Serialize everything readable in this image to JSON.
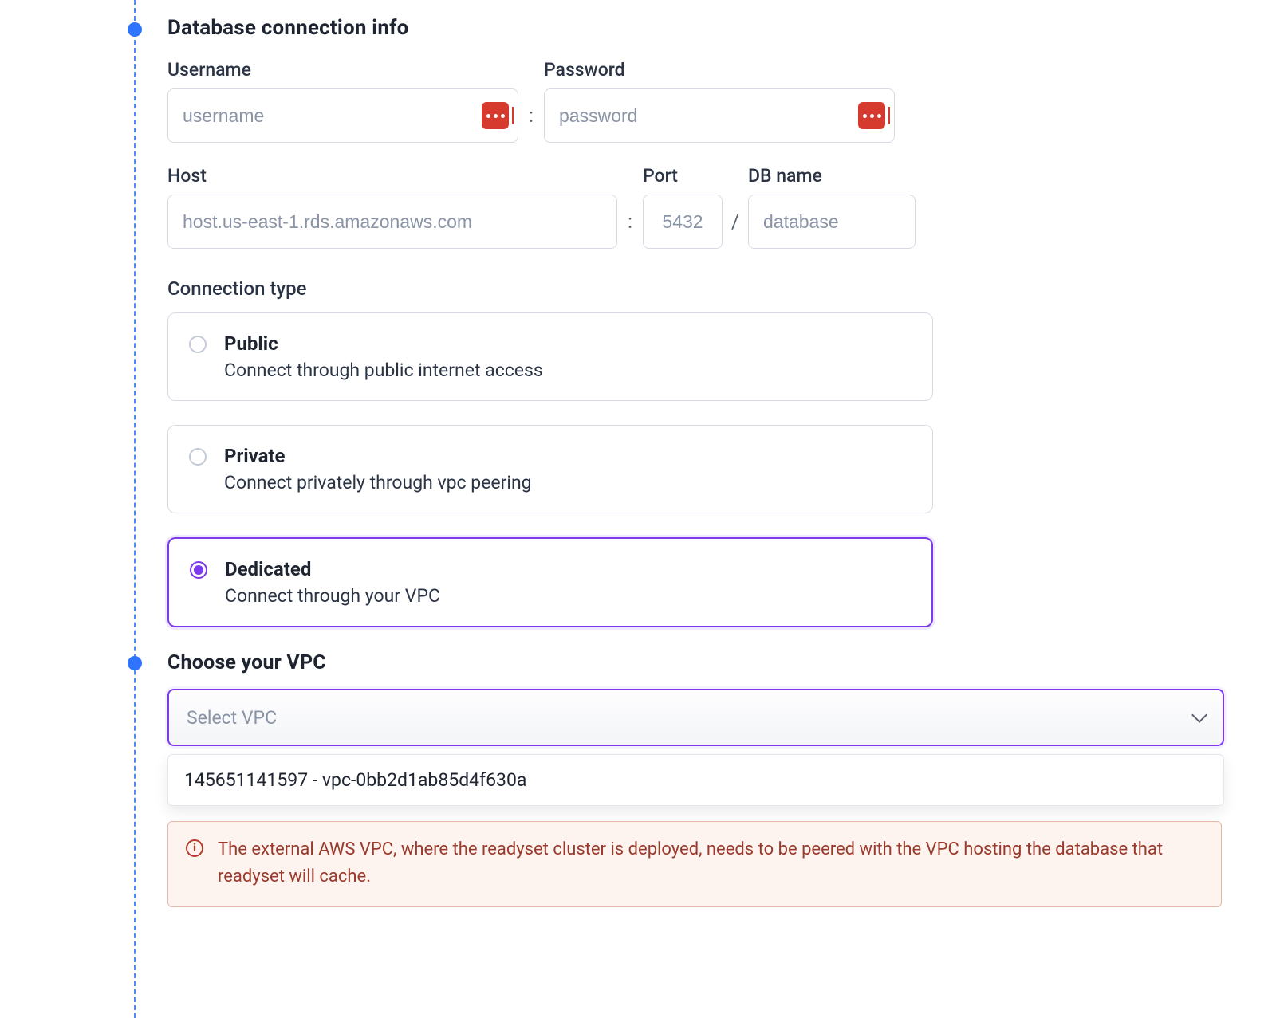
{
  "db_section": {
    "title": "Database connection info",
    "username": {
      "label": "Username",
      "placeholder": "username"
    },
    "password": {
      "label": "Password",
      "placeholder": "password"
    },
    "host": {
      "label": "Host",
      "placeholder": "host.us-east-1.rds.amazonaws.com"
    },
    "port": {
      "label": "Port",
      "placeholder": "5432"
    },
    "dbname": {
      "label": "DB name",
      "placeholder": "database"
    },
    "sep_colon": ":",
    "sep_slash": "/",
    "connection_type_label": "Connection type",
    "options": {
      "public": {
        "title": "Public",
        "desc": "Connect through public internet access"
      },
      "private": {
        "title": "Private",
        "desc": "Connect privately through vpc peering"
      },
      "dedicated": {
        "title": "Dedicated",
        "desc": "Connect through your VPC"
      }
    }
  },
  "vpc_section": {
    "title": "Choose your VPC",
    "placeholder": "Select VPC",
    "option": "145651141597 - vpc-0bb2d1ab85d4f630a",
    "alert": "The external AWS VPC, where the readyset cluster is deployed, needs to be peered with the VPC hosting the database that readyset will cache."
  }
}
